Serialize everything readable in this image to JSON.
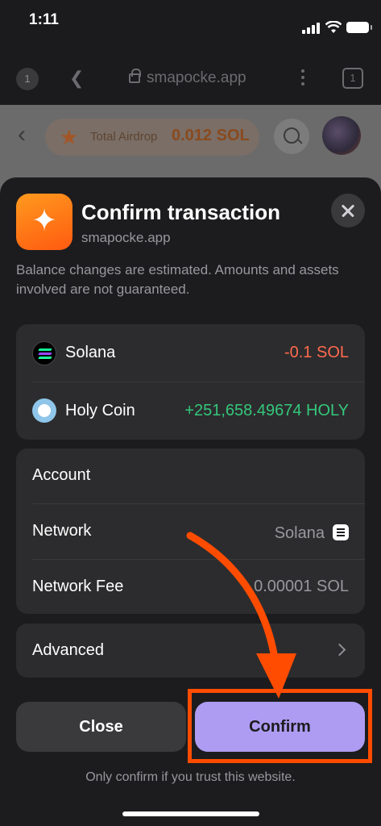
{
  "status_bar": {
    "time": "1:11"
  },
  "browser": {
    "tab_count_left": "1",
    "url": "smapocke.app",
    "tab_count_right": "1"
  },
  "webpage": {
    "airdrop_label": "Total Airdrop",
    "airdrop_amount": "0.012 SOL"
  },
  "sheet": {
    "title": "Confirm transaction",
    "subtitle": "smapocke.app",
    "notice": "Balance changes are estimated. Amounts and assets involved are not guaranteed.",
    "balance_changes": [
      {
        "token": "Solana",
        "amount": "-0.1 SOL",
        "color": "#ff6a4d"
      },
      {
        "token": "Holy Coin",
        "amount": "+251,658.49674 HOLY",
        "color": "#34c77b"
      }
    ],
    "details": {
      "account_label": "Account",
      "network_label": "Network",
      "network_value": "Solana",
      "fee_label": "Network Fee",
      "fee_value": "0.00001 SOL"
    },
    "advanced_label": "Advanced",
    "close_button": "Close",
    "confirm_button": "Confirm",
    "footer_note": "Only confirm if you trust this website."
  },
  "colors": {
    "confirm_bg": "#ae9cf2",
    "annotation": "#ff4c00"
  }
}
